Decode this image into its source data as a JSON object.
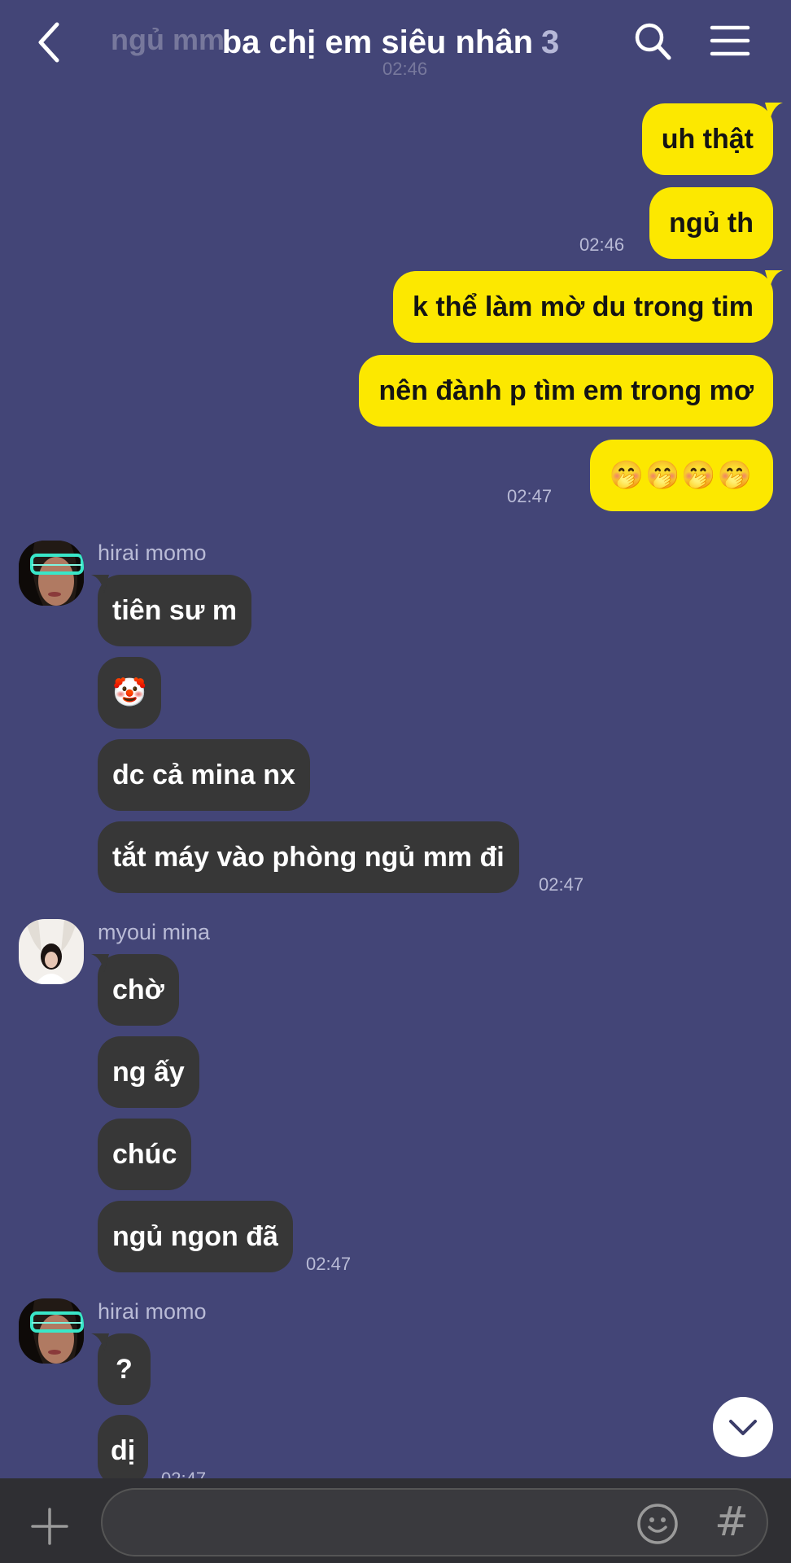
{
  "header": {
    "title": "ba chị em siêu nhân",
    "member_count": "3",
    "ghost_title": "ngủ mm",
    "ghost_time": "02:46"
  },
  "my_messages": [
    {
      "text": "uh thật"
    },
    {
      "text": "ngủ th",
      "time": "02:46"
    },
    {
      "text": "k thể làm mờ du trong tim"
    },
    {
      "text": "nên đành p tìm em trong mơ"
    },
    {
      "text": "🤭🤭🤭🤭",
      "time": "02:47"
    }
  ],
  "groups": [
    {
      "sender": "hirai momo",
      "messages": [
        {
          "text": "tiên sư m"
        },
        {
          "text": "🤡"
        },
        {
          "text": "dc cả mina nx"
        },
        {
          "text": "tắt máy vào phòng ngủ mm đi",
          "time": "02:47"
        }
      ]
    },
    {
      "sender": "myoui mina",
      "messages": [
        {
          "text": "chờ"
        },
        {
          "text": "ng ấy"
        },
        {
          "text": "chúc"
        },
        {
          "text": "ngủ ngon đã",
          "time": "02:47"
        }
      ]
    },
    {
      "sender": "hirai momo",
      "messages": [
        {
          "text": "?"
        },
        {
          "text": "dị",
          "time": "02:47"
        }
      ]
    }
  ],
  "input": {
    "placeholder": "",
    "value": ""
  },
  "colors": {
    "background": "#434577",
    "my_bubble": "#fce800",
    "their_bubble": "#373737",
    "bottom_bar": "#2f2f33"
  },
  "icons": {
    "back": "chevron-left-icon",
    "search": "search-icon",
    "menu": "hamburger-menu-icon",
    "scroll_down": "chevron-down-icon",
    "add": "plus-icon",
    "emoji": "smiley-icon",
    "hashtag": "hashtag-icon"
  }
}
